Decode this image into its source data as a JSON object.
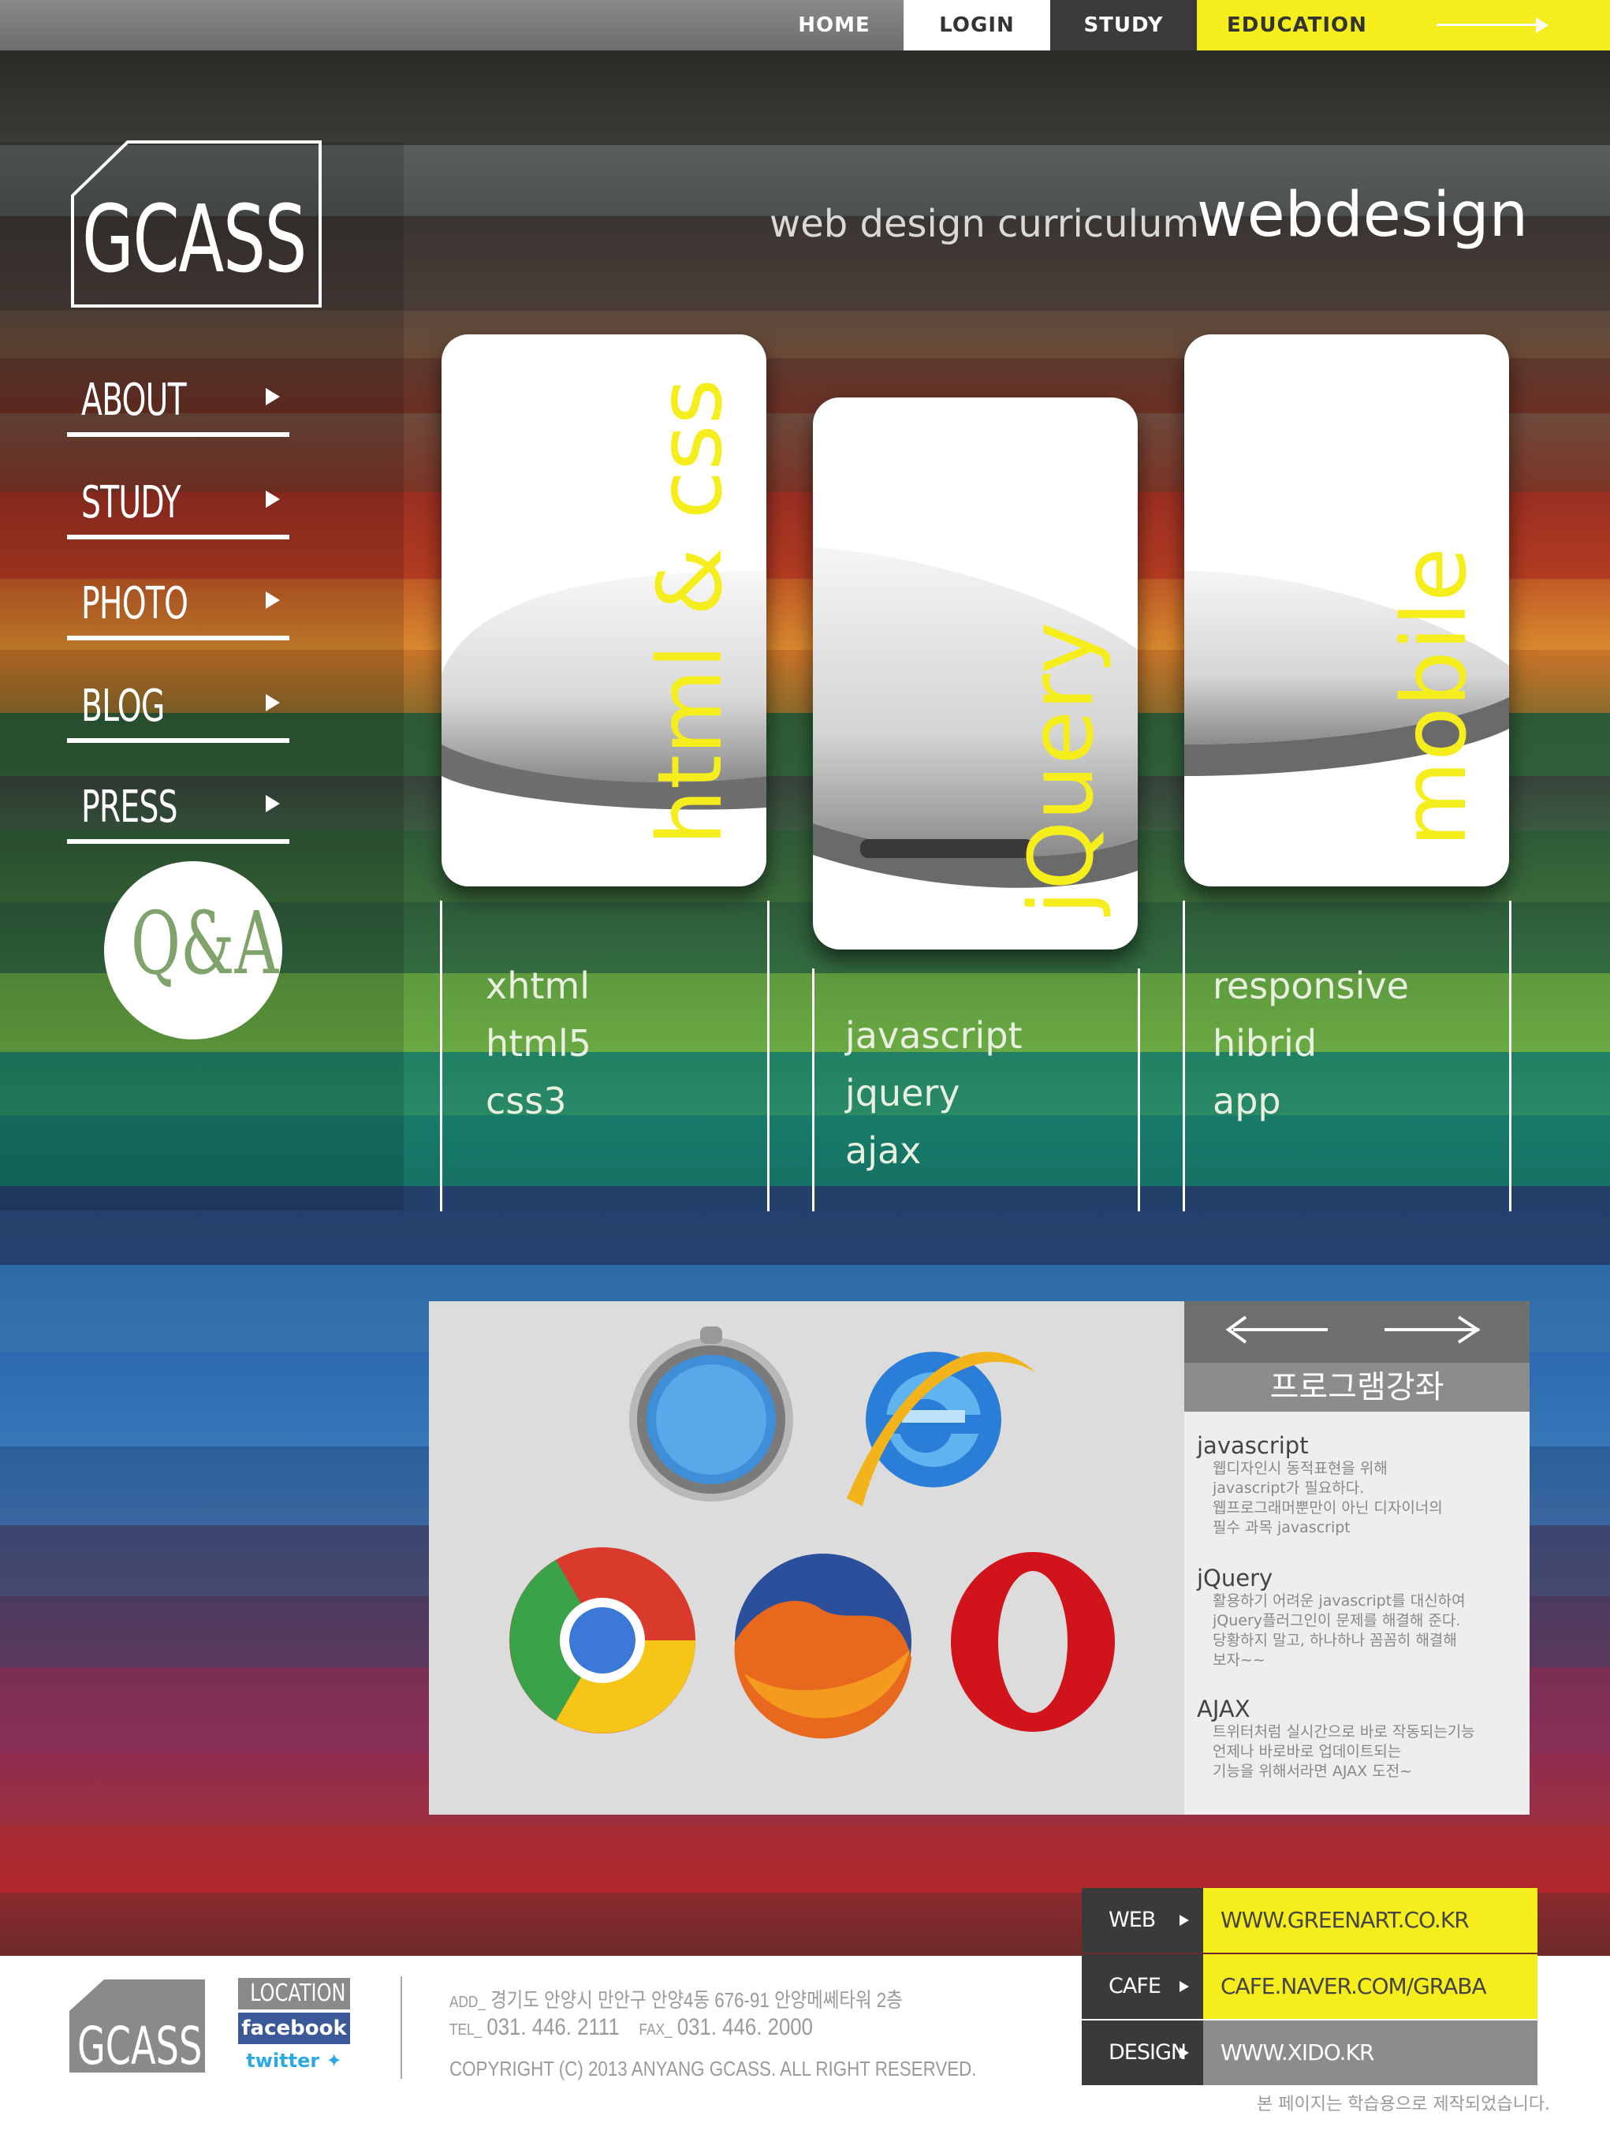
{
  "topbar": {
    "items": [
      {
        "label": "HOME"
      },
      {
        "label": "LOGIN"
      },
      {
        "label": "STUDY"
      },
      {
        "label": "EDUCATION"
      }
    ]
  },
  "logo": {
    "text": "GCASS"
  },
  "sidebar": {
    "items": [
      {
        "label": "ABOUT"
      },
      {
        "label": "STUDY"
      },
      {
        "label": "PHOTO"
      },
      {
        "label": "BLOG"
      },
      {
        "label": "PRESS"
      }
    ],
    "qa_label": "Q&A"
  },
  "header": {
    "subtitle": "web design curriculum",
    "title": "webdesign"
  },
  "cards": [
    {
      "title": "html & css",
      "items": [
        "xhtml",
        "html5",
        "css3"
      ]
    },
    {
      "title": "jQuery",
      "items": [
        "javascript",
        "jquery",
        "ajax"
      ]
    },
    {
      "title": "mobile",
      "items": [
        "responsive",
        "hibrid",
        "app"
      ]
    }
  ],
  "browsers": [
    "safari-icon",
    "internet-explorer-icon",
    "chrome-icon",
    "firefox-icon",
    "opera-icon"
  ],
  "program": {
    "title": "프로그램강좌",
    "sections": [
      {
        "heading": "javascript",
        "lines": [
          "웹디자인시 동적표현을 위해",
          "javascript가 필요하다.",
          "웹프로그래머뿐만이 아닌 디자이너의",
          "필수 과목 javascript"
        ]
      },
      {
        "heading": "jQuery",
        "lines": [
          "활용하기 어려운 javascript를 대신하여",
          "jQuery플러그인이 문제를 해결해 준다.",
          "당황하지 말고, 하나하나 꼼꼼히 해결해",
          "보자~~"
        ]
      },
      {
        "heading": "AJAX",
        "lines": [
          "트위터처럼 실시간으로 바로 작동되는기능",
          "언제나 바로바로 업데이트되는",
          "기능을 위해서라면 AJAX 도전~"
        ]
      }
    ]
  },
  "footer": {
    "logo": "GCASS",
    "social": {
      "location": "LOCATION",
      "facebook": "facebook",
      "twitter": "twitter"
    },
    "address_label": "ADD_",
    "address": "경기도 안양시 만안구 안양4동 676-91 안양메쎄타워 2층",
    "tel_label": "TEL_",
    "tel": "031. 446. 2111",
    "fax_label": "FAX_",
    "fax": "031. 446. 2000",
    "copyright": "COPYRIGHT (C) 2013 ANYANG GCASS. ALL RIGHT RESERVED.",
    "note": "본 페이지는 학습용으로 제작되었습니다."
  },
  "links": [
    {
      "key": "WEB",
      "value": "WWW.GREENART.CO.KR"
    },
    {
      "key": "CAFE",
      "value": "CAFE.NAVER.COM/GRABA"
    },
    {
      "key": "DESIGN",
      "value": "WWW.XIDO.KR"
    }
  ],
  "colors": {
    "accent_yellow": "#f5ee1c",
    "dark": "#3a3a3a",
    "gray": "#8c8c8c"
  }
}
